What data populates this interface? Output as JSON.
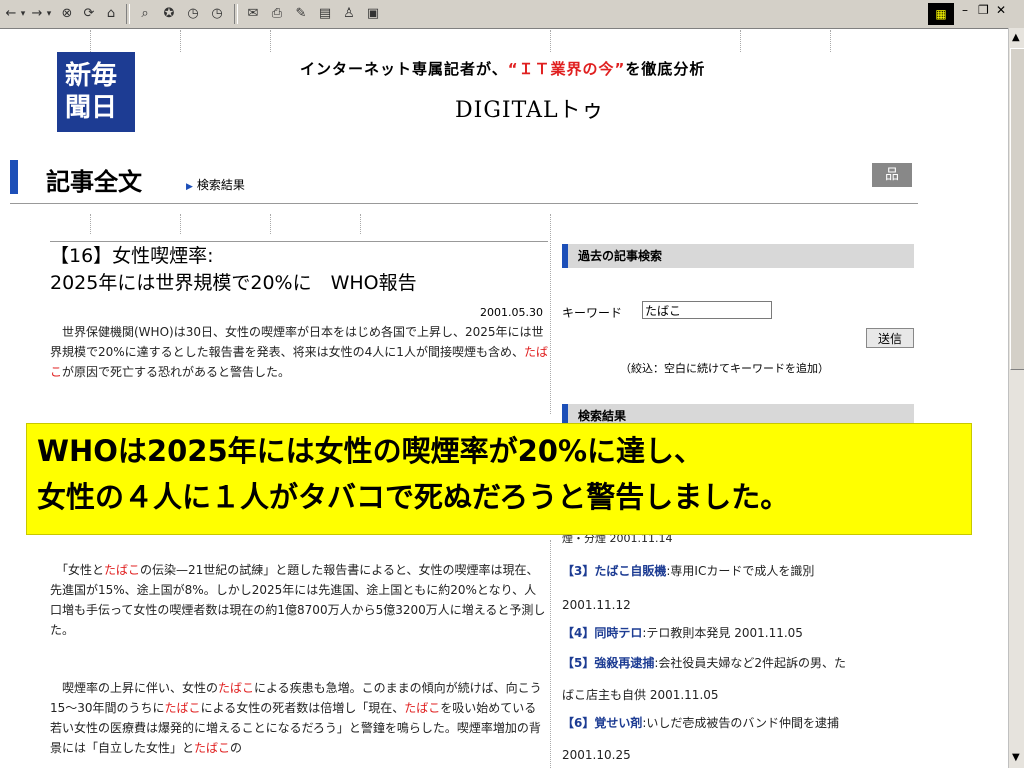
{
  "toolbar": {
    "icons": [
      "back-icon",
      "forward-icon",
      "stop-icon",
      "refresh-icon",
      "home-icon",
      "search-icon",
      "favorites-icon",
      "history-icon",
      "mail-icon",
      "print-icon",
      "edit-icon",
      "discuss-icon",
      "messenger-icon",
      "window-icon"
    ],
    "glyphs": {
      "back": "←",
      "dropdown": "▾",
      "forward": "→",
      "stop": "⊗",
      "refresh": "⟳",
      "home": "⌂",
      "search": "⌕",
      "favorites": "✪",
      "history": "◷",
      "mail": "✉",
      "print": "⎙",
      "edit": "✎",
      "discuss": "▤",
      "messenger": "♙",
      "window": "▣",
      "minimize": "–",
      "restore": "❐",
      "close": "✕",
      "win_logo": "▦"
    }
  },
  "header": {
    "logo_line1": "新毎",
    "logo_line2": "聞日",
    "tagline_pre": "インターネット専属記者が、",
    "tagline_red": "“ＩＴ業界の今”",
    "tagline_post": "を徹底分析",
    "site_title": "DIGITALトゥ"
  },
  "section": {
    "title": "記事全文",
    "breadcrumb": "検索結果",
    "grid_glyph": "品"
  },
  "article": {
    "title_line1": "【16】女性喫煙率:",
    "title_line2": "2025年には世界規模で20%に　WHO報告",
    "date": "2001.05.30",
    "p1": [
      {
        "t": "　世界保健機関(WHO)は30日、女性の喫煙率が日本をはじめ各国で上昇し、2025年には世界規模で20%に達するとした報告書を発表、将来は女性の4人に1人が間接喫煙も含め、"
      },
      {
        "t": "たばこ",
        "hl": true
      },
      {
        "t": "が原因で死亡する恐れがあると警告した。"
      }
    ],
    "p2": [
      {
        "t": "　「女性と"
      },
      {
        "t": "たばこ",
        "hl": true
      },
      {
        "t": "の伝染—21世紀の試練」と題した報告書によると、女性の喫煙率は現在、先進国が15%、途上国が8%。しかし2025年には先進国、途上国ともに約20%となり、人口増も手伝って女性の喫煙者数は現在の約1億8700万人から5億3200万人に増えると予測した。"
      }
    ],
    "p3": [
      {
        "t": "　喫煙率の上昇に伴い、女性の"
      },
      {
        "t": "たばこ",
        "hl": true
      },
      {
        "t": "による疾患も急増。このままの傾向が続けば、向こう15〜30年間のうちに"
      },
      {
        "t": "たばこ",
        "hl": true
      },
      {
        "t": "による女性の死者数は倍増し「現在、"
      },
      {
        "t": "たばこ",
        "hl": true
      },
      {
        "t": "を吸い始めている若い女性の医療費は爆発的に増えることになるだろう」と警鐘を鳴らした。喫煙率増加の背景には「自立した女性」と"
      },
      {
        "t": "たばこ",
        "hl": true
      },
      {
        "t": "の"
      }
    ]
  },
  "search_panel": {
    "heading": "過去の記事検索",
    "keyword_label": "キーワード",
    "keyword_value": "たばこ",
    "submit_label": "送信",
    "note": "（絞込：空白に続けてキーワードを追加）"
  },
  "results_panel": {
    "heading": "検索結果",
    "fragment": "煙・分煙 2001.11.14",
    "items": [
      {
        "title": "【3】たばこ自販機",
        "rest": ":専用ICカードで成人を識別",
        "date": "2001.11.12"
      },
      {
        "title": "【4】同時テロ",
        "rest": ":テロ教則本発見 2001.11.05",
        "date": ""
      },
      {
        "title": "【5】強殺再逮捕",
        "rest": ":会社役員夫婦など2件起訴の男、た",
        "date": "ばこ店主も自供 2001.11.05"
      },
      {
        "title": "【6】覚せい剤",
        "rest": ":いしだ壱成被告のバンド仲間を逮捕",
        "date": "2001.10.25"
      }
    ]
  },
  "caption": {
    "line1": "WHOは2025年には女性の喫煙率が20%に達し、",
    "line2": "女性の４人に１人がタバコで死ぬだろうと警告しました。"
  },
  "scrollbar": {
    "up": "▲",
    "down": "▼"
  },
  "colors": {
    "accent_blue": "#1d4fb8",
    "logo_blue": "#1d3c93",
    "highlight_red": "#e02020",
    "caption_yellow": "#ffff00"
  }
}
